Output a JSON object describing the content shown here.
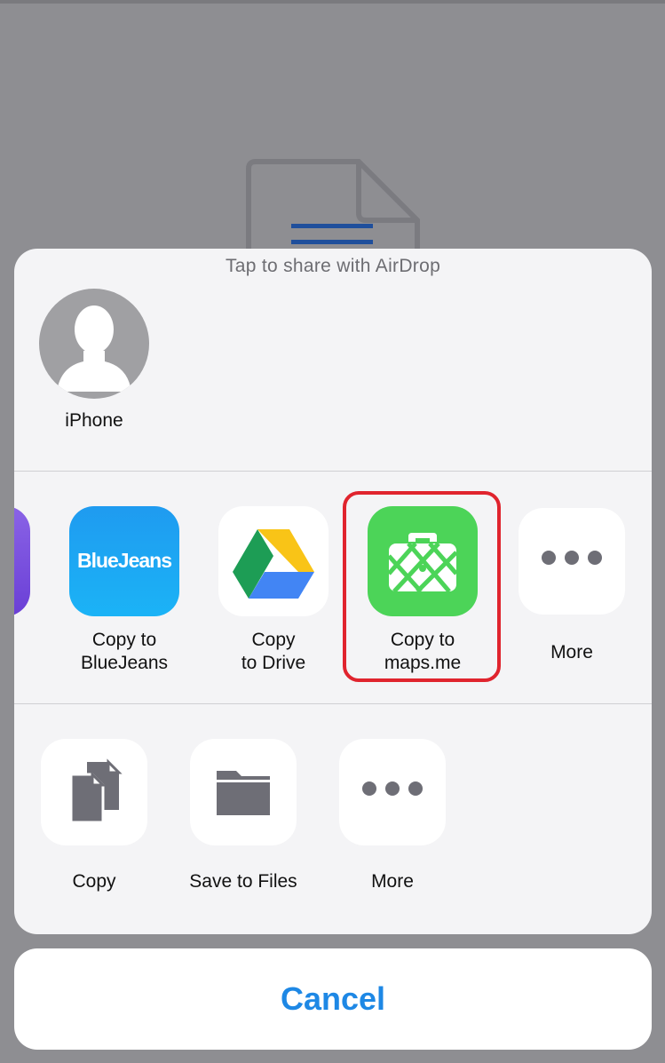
{
  "airdrop": {
    "title": "Tap to share with AirDrop",
    "device_name": "iPhone"
  },
  "apps": [
    {
      "name": "bluejeans",
      "label_line1": "Copy to",
      "label_line2": "BlueJeans",
      "icon_text": "BlueJeans",
      "color": "#1aa7ef"
    },
    {
      "name": "google-drive",
      "label_line1": "Copy",
      "label_line2": "to Drive",
      "color": "#ffffff"
    },
    {
      "name": "maps-me",
      "label_line1": "Copy to",
      "label_line2": "maps.me",
      "color": "#4cd458"
    },
    {
      "name": "more",
      "label_line1": "More"
    }
  ],
  "actions": [
    {
      "name": "copy",
      "label": "Copy"
    },
    {
      "name": "save-to-files",
      "label": "Save to Files"
    },
    {
      "name": "more",
      "label": "More"
    }
  ],
  "cancel_label": "Cancel",
  "colors": {
    "accent": "#1e88e5",
    "highlight": "#e0242e",
    "icon_gray": "#6e6e76"
  }
}
